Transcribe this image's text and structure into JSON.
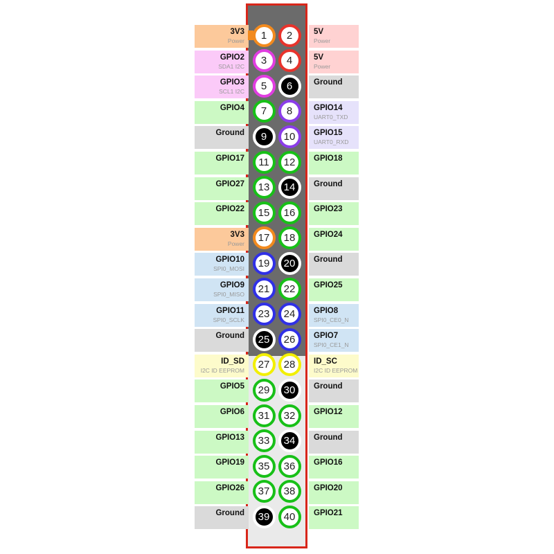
{
  "colors": {
    "power3v3": {
      "bg": "#fcc99b",
      "ring": "#f28a1e"
    },
    "power5v": {
      "bg": "#ffd2d2",
      "ring": "#e8332c"
    },
    "i2c": {
      "bg": "#fbcaf8",
      "ring": "#e03de0"
    },
    "gpio": {
      "bg": "#ccf9c4",
      "ring": "#18c018"
    },
    "ground": {
      "bg": "#dadada",
      "ring": "#ffffff"
    },
    "uart": {
      "bg": "#e6e2fb",
      "ring": "#8b3de9"
    },
    "spi": {
      "bg": "#d0e4f4",
      "ring": "#3030e6"
    },
    "id": {
      "bg": "#fdfbcb",
      "ring": "#f2ef00"
    },
    "frame": "#d8261a"
  },
  "pins": [
    {
      "n": "1",
      "name": "3V3",
      "sub": "Power",
      "type": "power3v3"
    },
    {
      "n": "2",
      "name": "5V",
      "sub": "Power",
      "type": "power5v"
    },
    {
      "n": "3",
      "name": "GPIO2",
      "sub": "SDA1 I2C",
      "type": "i2c"
    },
    {
      "n": "4",
      "name": "5V",
      "sub": "Power",
      "type": "power5v"
    },
    {
      "n": "5",
      "name": "GPIO3",
      "sub": "SCL1 I2C",
      "type": "i2c"
    },
    {
      "n": "6",
      "name": "Ground",
      "sub": "",
      "type": "ground"
    },
    {
      "n": "7",
      "name": "GPIO4",
      "sub": "",
      "type": "gpio"
    },
    {
      "n": "8",
      "name": "GPIO14",
      "sub": "UART0_TXD",
      "type": "uart"
    },
    {
      "n": "9",
      "name": "Ground",
      "sub": "",
      "type": "ground"
    },
    {
      "n": "10",
      "name": "GPIO15",
      "sub": "UART0_RXD",
      "type": "uart"
    },
    {
      "n": "11",
      "name": "GPIO17",
      "sub": "",
      "type": "gpio"
    },
    {
      "n": "12",
      "name": "GPIO18",
      "sub": "",
      "type": "gpio"
    },
    {
      "n": "13",
      "name": "GPIO27",
      "sub": "",
      "type": "gpio"
    },
    {
      "n": "14",
      "name": "Ground",
      "sub": "",
      "type": "ground"
    },
    {
      "n": "15",
      "name": "GPIO22",
      "sub": "",
      "type": "gpio"
    },
    {
      "n": "16",
      "name": "GPIO23",
      "sub": "",
      "type": "gpio"
    },
    {
      "n": "17",
      "name": "3V3",
      "sub": "Power",
      "type": "power3v3"
    },
    {
      "n": "18",
      "name": "GPIO24",
      "sub": "",
      "type": "gpio"
    },
    {
      "n": "19",
      "name": "GPIO10",
      "sub": "SPI0_MOSI",
      "type": "spi"
    },
    {
      "n": "20",
      "name": "Ground",
      "sub": "",
      "type": "ground"
    },
    {
      "n": "21",
      "name": "GPIO9",
      "sub": "SPI0_MISO",
      "type": "spi"
    },
    {
      "n": "22",
      "name": "GPIO25",
      "sub": "",
      "type": "gpio"
    },
    {
      "n": "23",
      "name": "GPIO11",
      "sub": "SPI0_SCLK",
      "type": "spi"
    },
    {
      "n": "24",
      "name": "GPIO8",
      "sub": "SPI0_CE0_N",
      "type": "spi"
    },
    {
      "n": "25",
      "name": "Ground",
      "sub": "",
      "type": "ground"
    },
    {
      "n": "26",
      "name": "GPIO7",
      "sub": "SPI0_CE1_N",
      "type": "spi"
    },
    {
      "n": "27",
      "name": "ID_SD",
      "sub": "I2C ID EEPROM",
      "type": "id"
    },
    {
      "n": "28",
      "name": "ID_SC",
      "sub": "I2C ID EEPROM",
      "type": "id"
    },
    {
      "n": "29",
      "name": "GPIO5",
      "sub": "",
      "type": "gpio"
    },
    {
      "n": "30",
      "name": "Ground",
      "sub": "",
      "type": "ground"
    },
    {
      "n": "31",
      "name": "GPIO6",
      "sub": "",
      "type": "gpio"
    },
    {
      "n": "32",
      "name": "GPIO12",
      "sub": "",
      "type": "gpio"
    },
    {
      "n": "33",
      "name": "GPIO13",
      "sub": "",
      "type": "gpio"
    },
    {
      "n": "34",
      "name": "Ground",
      "sub": "",
      "type": "ground"
    },
    {
      "n": "35",
      "name": "GPIO19",
      "sub": "",
      "type": "gpio"
    },
    {
      "n": "36",
      "name": "GPIO16",
      "sub": "",
      "type": "gpio"
    },
    {
      "n": "37",
      "name": "GPIO26",
      "sub": "",
      "type": "gpio"
    },
    {
      "n": "38",
      "name": "GPIO20",
      "sub": "",
      "type": "gpio"
    },
    {
      "n": "39",
      "name": "Ground",
      "sub": "",
      "type": "ground"
    },
    {
      "n": "40",
      "name": "GPIO21",
      "sub": "",
      "type": "gpio"
    }
  ]
}
